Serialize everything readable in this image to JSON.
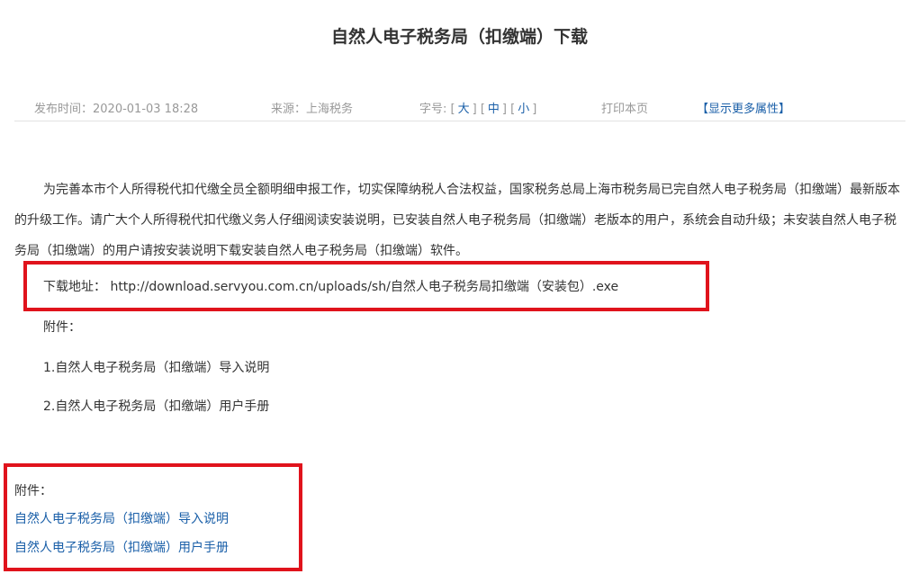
{
  "article": {
    "title": "自然人电子税务局（扣缴端）下载",
    "meta": {
      "publish_time": "发布时间：2020-01-03 18:28",
      "source": "来源：上海税务",
      "font_size_label": "字号:",
      "size_large": "大",
      "size_medium": "中",
      "size_small": "小",
      "print": "打印本页",
      "show_more": "【显示更多属性】"
    },
    "body": "为完善本市个人所得税代扣代缴全员全额明细申报工作，切实保障纳税人合法权益，国家税务总局上海市税务局已完自然人电子税务局（扣缴端）最新版本的升级工作。请广大个人所得税代扣代缴义务人仔细阅读安装说明，已安装自然人电子税务局（扣缴端）老版本的用户，系统会自动升级；未安装自然人电子税务局（扣缴端）的用户请按安装说明下载安装自然人电子税务局（扣缴端）软件。",
    "download": "下载地址： http://download.servyou.com.cn/uploads/sh/自然人电子税务局扣缴端（安装包）.exe",
    "attachments_label": "附件：",
    "attachment_1": "1.自然人电子税务局（扣缴端）导入说明",
    "attachment_2": "2.自然人电子税务局（扣缴端）用户手册"
  },
  "attachments_section": {
    "label": "附件：",
    "links": [
      "自然人电子税务局（扣缴端）导入说明",
      "自然人电子税务局（扣缴端）用户手册"
    ]
  },
  "colors": {
    "link": "#1a5fa8",
    "highlight": "#e0131c",
    "meta_text": "#999999"
  }
}
